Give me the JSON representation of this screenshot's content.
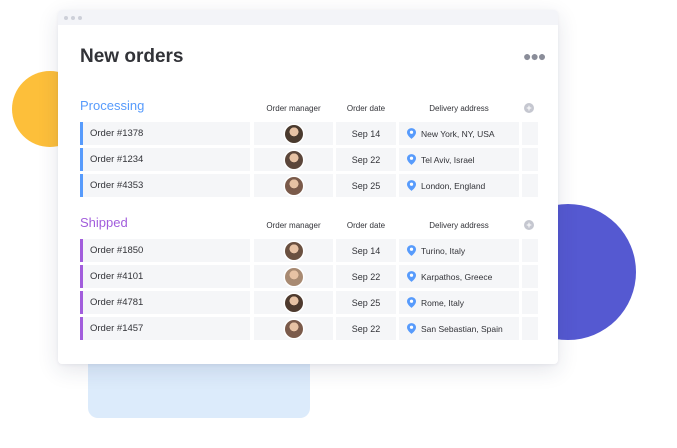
{
  "colors": {
    "processing": "#579bfc",
    "shipped": "#a25ddc"
  },
  "window": {
    "title": "New orders",
    "more_icon": "more-horizontal-icon"
  },
  "columns": {
    "manager": "Order manager",
    "date": "Order date",
    "address": "Delivery address",
    "add_icon": "add-column-icon"
  },
  "groups": [
    {
      "name": "Processing",
      "rows": [
        {
          "order": "Order #1378",
          "date": "Sep 14",
          "address": "New York, NY, USA",
          "avatar_color": "#4a3a2e"
        },
        {
          "order": "Order #1234",
          "date": "Sep 22",
          "address": "Tel Aviv, Israel",
          "avatar_color": "#5b463a"
        },
        {
          "order": "Order #4353",
          "date": "Sep 25",
          "address": "London, England",
          "avatar_color": "#7a5a4a"
        }
      ]
    },
    {
      "name": "Shipped",
      "rows": [
        {
          "order": "Order #1850",
          "date": "Sep 14",
          "address": "Turino, Italy",
          "avatar_color": "#6a5040"
        },
        {
          "order": "Order #4101",
          "date": "Sep 22",
          "address": "Karpathos, Greece",
          "avatar_color": "#a88a72"
        },
        {
          "order": "Order #4781",
          "date": "Sep 25",
          "address": "Rome, Italy",
          "avatar_color": "#4e3a2e"
        },
        {
          "order": "Order #1457",
          "date": "Sep 22",
          "address": "San Sebastian, Spain",
          "avatar_color": "#7a5a4a"
        }
      ]
    }
  ]
}
